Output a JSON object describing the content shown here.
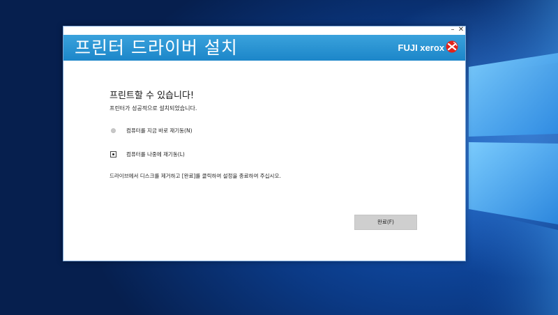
{
  "window": {
    "minimize_glyph": "–",
    "close_glyph": "✕"
  },
  "banner": {
    "title": "프린터 드라이버 설치",
    "brand": "FUJI xerox",
    "brand_icon": "fuji-xerox-logo-icon"
  },
  "content": {
    "heading": "프린트할 수 있습니다!",
    "subtext": "프린터가 성공적으로 설치되었습니다.",
    "options": [
      {
        "label": "컴퓨터를 지금 바로 재기동(N)",
        "selected": false
      },
      {
        "label": "컴퓨터를 나중에 재기동(L)",
        "selected": true
      }
    ],
    "instruction": "드라이브에서 디스크를 제거하고 [완료]를 클릭하여 설정을 종료하여 주십시오.",
    "finish_label": "완료(F)"
  },
  "colors": {
    "banner_blue": "#1c86c9",
    "desktop_blue": "#0b3a86",
    "brand_red": "#e2231a",
    "button_gray": "#cfcfcf"
  }
}
